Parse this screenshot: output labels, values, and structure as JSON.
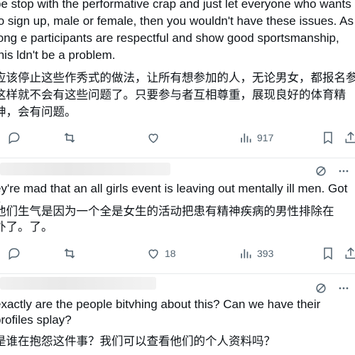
{
  "posts": [
    {
      "text_en": "pe stop with the performative crap and just let everyone who wants to sign up, male or female, then you wouldn't have these issues. As long e participants are respectful and show good sportsmanship, this ldn't be a problem.",
      "text_zh": "应该停止这些作秀式的做法，让所有想参加的人，无论男女，都报名参这样就不会有这些问题了。只要参与者互相尊重，展现良好的体育精神，会有问题。",
      "likes": "",
      "views": "917"
    },
    {
      "text_en": "ey're mad that an all girls event is leaving out mentally ill men. Got it.",
      "text_zh": "他们生气是因为一个全是女生的活动把患有精神疾病的男性排除在外了。了。",
      "likes": "18",
      "views": "393"
    },
    {
      "text_en": "exactly are the people bitvhing about this? Can we have their profiles splay?",
      "text_zh": "是谁在抱怨这件事？我们可以查看他们的个人资料吗？"
    }
  ],
  "icons": [
    "reply-icon",
    "retweet-icon",
    "like-icon",
    "views-icon",
    "bookmark-icon",
    "share-icon",
    "grok-icon",
    "more-icon"
  ]
}
